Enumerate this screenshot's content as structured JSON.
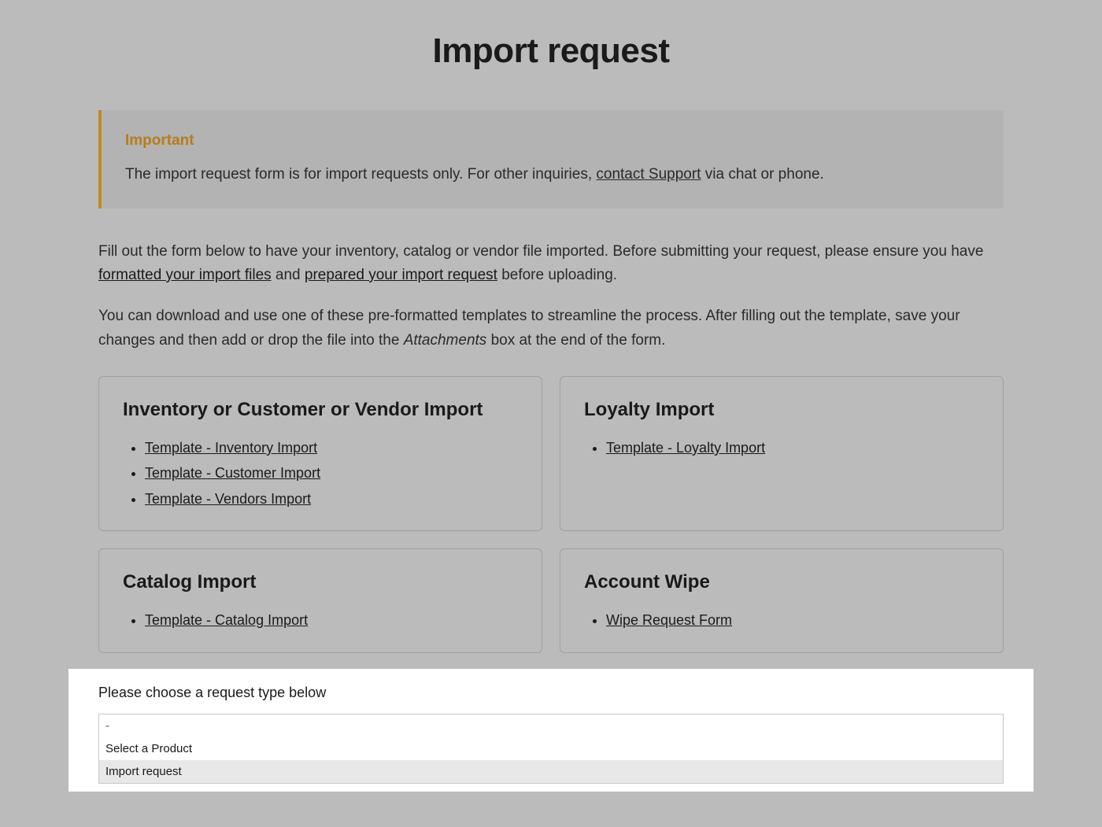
{
  "page_title": "Import request",
  "callout": {
    "title": "Important",
    "text_before": "The import request form is for import requests only. For other inquiries, ",
    "link_text": "contact Support",
    "text_after": " via chat or phone."
  },
  "intro1": {
    "before_link1": "Fill out the form below to have your inventory, catalog or vendor file imported. Before submitting your request, please ensure you have ",
    "link1": "formatted your import files",
    "between": " and ",
    "link2": "prepared your import request",
    "after": " before uploading."
  },
  "intro2": {
    "before_em": "You can download and use one of these pre-formatted templates to streamline the process. After filling out the template, save your changes and then add or drop the file into the ",
    "em": "Attachments",
    "after_em": " box at the end of the form."
  },
  "cards": {
    "inventory": {
      "title": "Inventory or Customer or Vendor Import",
      "links": [
        "Template - Inventory Import",
        "Template - Customer Import",
        "Template - Vendors Import"
      ]
    },
    "loyalty": {
      "title": "Loyalty Import",
      "links": [
        "Template - Loyalty Import"
      ]
    },
    "catalog": {
      "title": "Catalog Import",
      "links": [
        "Template - Catalog Import"
      ]
    },
    "wipe": {
      "title": "Account Wipe",
      "links": [
        "Wipe Request Form"
      ]
    }
  },
  "form": {
    "label": "Please choose a request type below",
    "options": [
      "-",
      "Select a Product",
      "Import request"
    ]
  }
}
